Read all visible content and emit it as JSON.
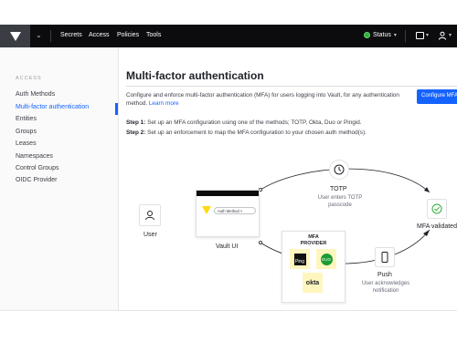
{
  "topnav": {
    "links": [
      "Secrets",
      "Access",
      "Policies",
      "Tools"
    ],
    "status_label": "Status"
  },
  "sidebar": {
    "heading": "ACCESS",
    "items": [
      {
        "label": "Auth Methods",
        "active": false
      },
      {
        "label": "Multi-factor authentication",
        "active": true
      },
      {
        "label": "Entities",
        "active": false
      },
      {
        "label": "Groups",
        "active": false
      },
      {
        "label": "Leases",
        "active": false
      },
      {
        "label": "Namespaces",
        "active": false
      },
      {
        "label": "Control Groups",
        "active": false
      },
      {
        "label": "OIDC Provider",
        "active": false
      }
    ]
  },
  "main": {
    "title": "Multi-factor authentication",
    "intro": "Configure and enforce multi-factor authentication (MFA) for users logging into Vault, for any authentication method.",
    "learn_more": "Learn more",
    "configure_button": "Configure MFA",
    "step1_label": "Step 1:",
    "step1_text": "Set up an MFA configuration using one of the methods; TOTP, Okta, Duo or Pingid.",
    "step2_label": "Step 2:",
    "step2_text": "Set up an enforcement to map the MFA configuration to your chosen auth method(s)."
  },
  "diagram": {
    "user_label": "User",
    "vault_label": "Vault UI",
    "auth_method_pill": "Auth Method",
    "totp_label": "TOTP",
    "totp_sub_1": "User enters TOTP",
    "totp_sub_2": "passcode",
    "mfa_validated": "MFA validated",
    "provider_label_1": "MFA",
    "provider_label_2": "PROVIDER",
    "ping_label": "Ping",
    "duo_label": "DUO",
    "okta_label": "okta",
    "push_label": "Push",
    "push_sub_1": "User acknowledges",
    "push_sub_2": "notification"
  },
  "colors": {
    "nav_bg": "#0c0c0e",
    "accent": "#1563ff",
    "status_green": "#2eb039",
    "vault_yellow": "#ffd814",
    "check_green": "#2eb039"
  }
}
